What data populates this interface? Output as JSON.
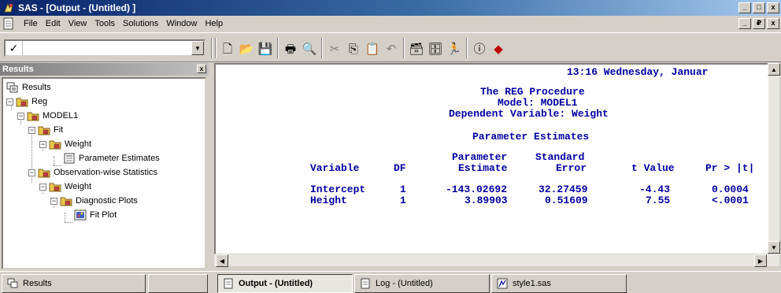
{
  "window": {
    "title": "SAS - [Output - (Untitled) ]",
    "controls": [
      "_",
      "□",
      "x"
    ],
    "mdi_controls": [
      "_",
      "₽",
      "x"
    ]
  },
  "menu": {
    "items": [
      "File",
      "Edit",
      "View",
      "Tools",
      "Solutions",
      "Window",
      "Help"
    ]
  },
  "toolbar": {
    "command_value": "",
    "check_glyph": "✓",
    "dropdown_glyph": "▼",
    "buttons": [
      {
        "name": "new-icon",
        "glyph": "🗋"
      },
      {
        "name": "open-icon",
        "glyph": "📂"
      },
      {
        "name": "save-icon",
        "glyph": "💾"
      },
      {
        "name": "print-icon",
        "glyph": "🖶"
      },
      {
        "name": "print-preview-icon",
        "glyph": "🔍"
      },
      {
        "name": "cut-icon",
        "glyph": "✂"
      },
      {
        "name": "copy-icon",
        "glyph": "⎘"
      },
      {
        "name": "paste-icon",
        "glyph": "📋"
      },
      {
        "name": "undo-icon",
        "glyph": "↶"
      },
      {
        "name": "explorer-icon",
        "glyph": "🗃"
      },
      {
        "name": "libraries-icon",
        "glyph": "🗄"
      },
      {
        "name": "submit-icon",
        "glyph": "🏃"
      },
      {
        "name": "help-icon",
        "glyph": "ⓘ"
      },
      {
        "name": "bookmark-icon",
        "glyph": "◆"
      }
    ]
  },
  "results": {
    "header": "Results",
    "close_glyph": "x",
    "tree": [
      {
        "label": "Results",
        "level": 0,
        "expander": "",
        "icon": "results"
      },
      {
        "label": "Reg",
        "level": 0,
        "expander": "−",
        "icon": "folder"
      },
      {
        "label": "MODEL1",
        "level": 1,
        "expander": "−",
        "icon": "folder"
      },
      {
        "label": "Fit",
        "level": 2,
        "expander": "−",
        "icon": "folder"
      },
      {
        "label": "Weight",
        "level": 3,
        "expander": "−",
        "icon": "folder"
      },
      {
        "label": "Parameter Estimates",
        "level": 4,
        "expander": "",
        "icon": "table"
      },
      {
        "label": "Observation-wise Statistics",
        "level": 2,
        "expander": "−",
        "icon": "folder"
      },
      {
        "label": "Weight",
        "level": 3,
        "expander": "−",
        "icon": "folder"
      },
      {
        "label": "Diagnostic Plots",
        "level": 4,
        "expander": "−",
        "icon": "folder"
      },
      {
        "label": "Fit Plot",
        "level": 5,
        "expander": "",
        "icon": "plot"
      }
    ]
  },
  "output": {
    "timestamp": "13:16 Wednesday, Januar",
    "procedure": "The REG Procedure",
    "model": "Model: MODEL1",
    "dependent": "Dependent Variable: Weight",
    "section": "Parameter Estimates",
    "columns": [
      {
        "line1": "",
        "line2": "Variable"
      },
      {
        "line1": "",
        "line2": "DF"
      },
      {
        "line1": "Parameter",
        "line2": "Estimate"
      },
      {
        "line1": "Standard",
        "line2": "Error"
      },
      {
        "line1": "",
        "line2": "t Value"
      },
      {
        "line1": "",
        "line2": "Pr > |t|"
      }
    ],
    "rows": [
      [
        "Intercept",
        "1",
        "-143.02692",
        "32.27459",
        "-4.43",
        "0.0004"
      ],
      [
        "Height",
        "1",
        "3.89903",
        "0.51609",
        "7.55",
        "<.0001"
      ]
    ]
  },
  "scroll": {
    "left": "◀",
    "right": "▶",
    "up": "▲",
    "down": "▼"
  },
  "bottom_tabs": {
    "results_tab": "Results",
    "tabs": [
      {
        "label": "Output - (Untitled)",
        "active": true
      },
      {
        "label": "Log - (Untitled)",
        "active": false
      },
      {
        "label": "style1.sas",
        "active": false
      }
    ]
  },
  "colors": {
    "output_text": "#0000a0",
    "title_bar_start": "#0a246a",
    "title_bar_end": "#a6caf0",
    "chrome": "#d4d0c8"
  }
}
